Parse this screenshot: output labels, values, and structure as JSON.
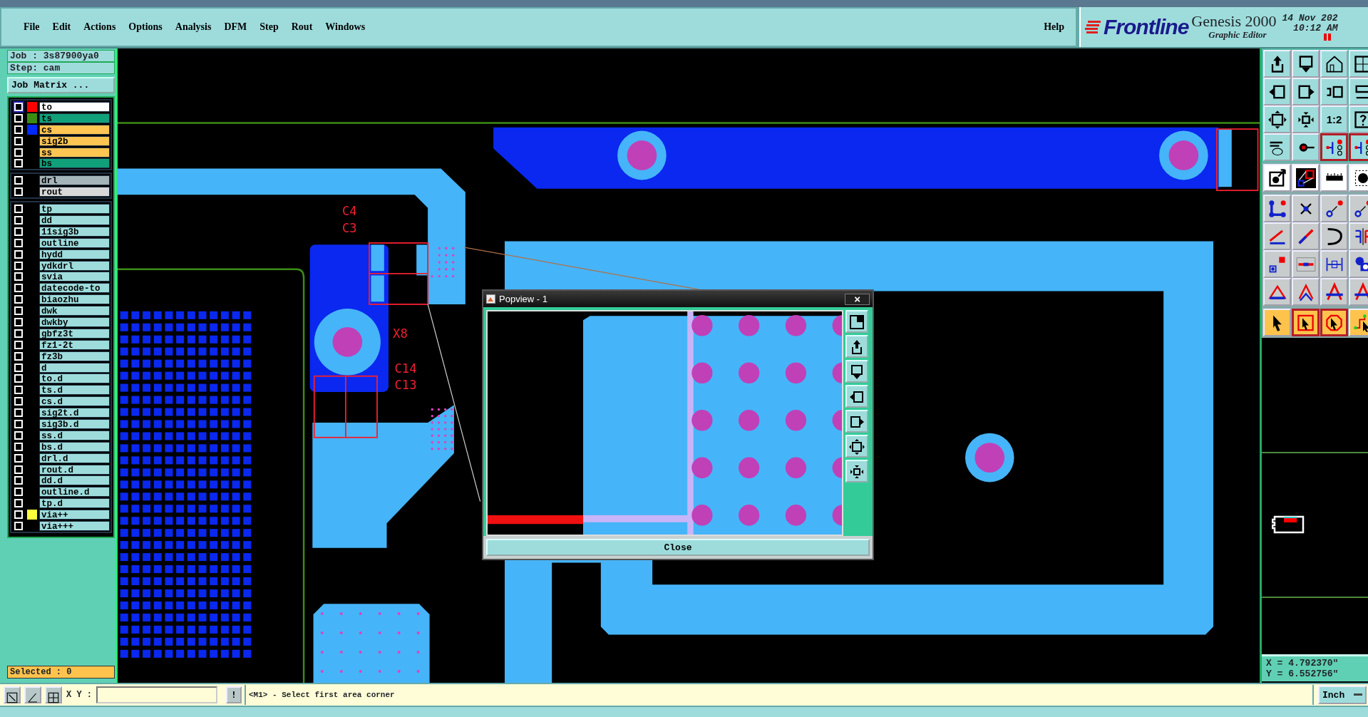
{
  "menu": {
    "items": [
      "File",
      "Edit",
      "Actions",
      "Options",
      "Analysis",
      "DFM",
      "Step",
      "Rout",
      "Windows"
    ],
    "help": "Help"
  },
  "branding": {
    "logo": "Frontline",
    "product": "Genesis 2000",
    "subtitle": "Graphic Editor",
    "date": "14 Nov 202",
    "time": "10:12 AM"
  },
  "job": {
    "job": "Job : 3s87900ya0",
    "step": "Step: cam",
    "matrix_button": "Job Matrix ..."
  },
  "layer_groups": [
    [
      {
        "name": "to",
        "work": true,
        "checked": false,
        "color": "#ff0000"
      },
      {
        "name": "ts",
        "kind": "mask",
        "work": false,
        "checked": false,
        "color": "#3c8c14"
      },
      {
        "name": "cs",
        "kind": "signal",
        "work": false,
        "checked": false,
        "color": "#0028ff"
      },
      {
        "name": "sig2b",
        "kind": "signal",
        "work": false,
        "checked": false
      },
      {
        "name": "ss",
        "kind": "signal",
        "work": false,
        "checked": false
      },
      {
        "name": "bs",
        "kind": "mask",
        "work": false,
        "checked": false
      }
    ],
    [
      {
        "name": "drl",
        "kind": "drill",
        "work": false,
        "checked": false
      },
      {
        "name": "rout",
        "kind": "rout",
        "work": false,
        "checked": false
      }
    ],
    [
      {
        "name": "tp",
        "kind": "misc",
        "work": false,
        "checked": false
      },
      {
        "name": "dd",
        "kind": "misc",
        "work": false,
        "checked": false
      },
      {
        "name": "11sig3b",
        "kind": "misc",
        "work": false,
        "checked": false
      },
      {
        "name": "outline",
        "kind": "misc",
        "work": false,
        "checked": false
      },
      {
        "name": "hydd",
        "kind": "misc",
        "work": false,
        "checked": false
      },
      {
        "name": "ydkdrl",
        "kind": "misc",
        "work": false,
        "checked": false
      },
      {
        "name": "svia",
        "kind": "misc",
        "work": false,
        "checked": false
      },
      {
        "name": "datecode-to",
        "kind": "misc",
        "work": false,
        "checked": false
      },
      {
        "name": "biaozhu",
        "kind": "misc",
        "work": false,
        "checked": false
      },
      {
        "name": "dwk",
        "kind": "misc",
        "work": false,
        "checked": false
      },
      {
        "name": "dwkby",
        "kind": "misc",
        "work": false,
        "checked": false
      },
      {
        "name": "gbfz3t",
        "kind": "misc",
        "work": false,
        "checked": false
      },
      {
        "name": "fz1-2t",
        "kind": "misc",
        "work": false,
        "checked": false
      },
      {
        "name": "fz3b",
        "kind": "misc",
        "work": false,
        "checked": false
      },
      {
        "name": "d",
        "kind": "misc",
        "work": false,
        "checked": false
      },
      {
        "name": "to.d",
        "kind": "misc",
        "work": false,
        "checked": false
      },
      {
        "name": "ts.d",
        "kind": "misc",
        "work": false,
        "checked": false
      },
      {
        "name": "cs.d",
        "kind": "misc",
        "work": false,
        "checked": false
      },
      {
        "name": "sig2t.d",
        "kind": "misc",
        "work": false,
        "checked": false
      },
      {
        "name": "sig3b.d",
        "kind": "misc",
        "work": false,
        "checked": false
      },
      {
        "name": "ss.d",
        "kind": "misc",
        "work": false,
        "checked": false
      },
      {
        "name": "bs.d",
        "kind": "misc",
        "work": false,
        "checked": false
      },
      {
        "name": "drl.d",
        "kind": "misc",
        "work": false,
        "checked": false
      },
      {
        "name": "rout.d",
        "kind": "misc",
        "work": false,
        "checked": false
      },
      {
        "name": "dd.d",
        "kind": "misc",
        "work": false,
        "checked": false
      },
      {
        "name": "outline.d",
        "kind": "misc",
        "work": false,
        "checked": false
      },
      {
        "name": "tp.d",
        "kind": "misc",
        "work": false,
        "checked": false
      },
      {
        "name": "via++",
        "kind": "misc",
        "work": false,
        "checked": false,
        "color": "#ffff3c"
      },
      {
        "name": "via+++",
        "kind": "misc",
        "work": false,
        "checked": false
      }
    ]
  ],
  "selected_count": "Selected : 0",
  "canvas": {
    "labels": [
      "C4",
      "C3",
      "X8",
      "C14",
      "C13"
    ]
  },
  "popview": {
    "title": "Popview - 1",
    "close_glyph": "×",
    "tools": [
      {
        "kind": "window-in"
      },
      {
        "kind": "tray-up"
      },
      {
        "kind": "tray-down"
      },
      {
        "kind": "arrow-left-box"
      },
      {
        "kind": "arrow-right-box"
      },
      {
        "kind": "expand-box"
      },
      {
        "kind": "compress-box"
      }
    ],
    "close_label": "Close"
  },
  "toolbar": {
    "groups": [
      {
        "kind": "teal",
        "buttons": [
          {
            "kind": "tray-up",
            "on": false
          },
          {
            "kind": "tray-down",
            "on": false
          },
          {
            "kind": "house",
            "on": false
          },
          {
            "kind": "grid-xy",
            "on": false
          },
          {
            "kind": "arrow-left-box",
            "on": false
          },
          {
            "kind": "arrow-right-box",
            "on": false
          },
          {
            "kind": "undo-box",
            "on": false
          },
          {
            "kind": "s-curve",
            "on": false
          },
          {
            "kind": "expand-box",
            "on": false
          },
          {
            "kind": "compress-box",
            "on": false
          },
          {
            "kind": "text",
            "label": "1:2",
            "on": false
          },
          {
            "kind": "question",
            "on": false
          },
          {
            "kind": "wrench",
            "on": false
          },
          {
            "kind": "knob",
            "on": false
          },
          {
            "kind": "circuit-light",
            "on": true
          },
          {
            "kind": "circuit-light",
            "on": true
          }
        ]
      },
      {
        "kind": "white",
        "buttons": [
          {
            "kind": "circle-arrow",
            "on": false
          },
          {
            "kind": "split-squares",
            "on": false
          },
          {
            "kind": "ruler",
            "on": false
          },
          {
            "kind": "dashed-circle",
            "on": false
          }
        ]
      },
      {
        "kind": "grey",
        "buttons": [
          {
            "kind": "node-graph",
            "on": false
          },
          {
            "kind": "cross-dot",
            "on": false
          },
          {
            "kind": "circle-move",
            "on": false
          },
          {
            "kind": "circle-move",
            "on": false
          },
          {
            "kind": "angle-line",
            "on": false
          },
          {
            "kind": "diagonal-line",
            "on": false
          },
          {
            "kind": "rotate-arrow",
            "on": false
          },
          {
            "kind": "mirror",
            "on": false
          },
          {
            "kind": "square-move",
            "on": false
          },
          {
            "kind": "short-line",
            "on": false
          },
          {
            "kind": "width-gauge",
            "on": false
          },
          {
            "kind": "blob-shapes",
            "on": false
          },
          {
            "kind": "triangle",
            "on": false
          },
          {
            "kind": "double-chevron",
            "on": false
          },
          {
            "kind": "arch",
            "on": false
          },
          {
            "kind": "arch",
            "on": false
          }
        ]
      },
      {
        "kind": "orange",
        "buttons": [
          {
            "kind": "pointer",
            "on": false
          },
          {
            "kind": "pointer-square",
            "on": true
          },
          {
            "kind": "pointer-octagon",
            "on": true
          },
          {
            "kind": "pointer-path",
            "on": false
          }
        ]
      }
    ]
  },
  "coords": {
    "x": "X = 4.792370\"",
    "y": "Y = 6.552756\""
  },
  "bottom": {
    "tools": [
      {
        "kind": "select-area"
      },
      {
        "kind": "measure"
      },
      {
        "kind": "grid-snap"
      }
    ],
    "xy_label": "X Y :",
    "bang": "!",
    "message": "<M1> - Select first area corner",
    "units": "Inch"
  }
}
